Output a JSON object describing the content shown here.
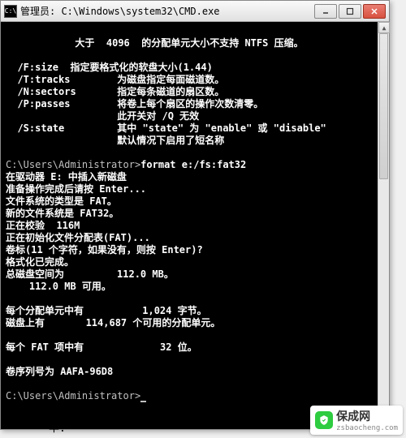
{
  "titlebar": {
    "icon_label": "C:\\",
    "text": "管理员: C:\\Windows\\system32\\CMD.exe"
  },
  "win_controls": {
    "min": "–",
    "max": "□",
    "close": "×"
  },
  "term": {
    "header_line": "大于  4096  的分配单元大小不支持 NTFS 压缩。",
    "opts": {
      "fsize": "  /F:size  指定要格式化的软盘大小(1.44)",
      "ttracks": "  /T:tracks        为磁盘指定每面磁道数。",
      "nsectors": "  /N:sectors       指定每条磁道的扇区数。",
      "ppasses": "  /P:passes        将卷上每个扇区的操作次数清零。",
      "ppasses2": "                   此开关对 /Q 无效",
      "sstate": "  /S:state         其中 \"state\" 为 \"enable\" 或 \"disable\"",
      "sstate2": "                   默认情况下启用了短名称"
    },
    "prompt1": "C:\\Users\\Administrator>",
    "cmd1": "format e:/fs:fat32",
    "body": [
      "在驱动器 E: 中插入新磁盘",
      "准备操作完成后请按 Enter...",
      "文件系统的类型是 FAT。",
      "新的文件系统是 FAT32。",
      "正在校验  116M",
      "正在初始化文件分配表(FAT)...",
      "卷标(11 个字符，如果没有，则按 Enter)?",
      "格式化已完成。",
      "总磁盘空间为         112.0 MB。",
      "    112.0 MB 可用。",
      "",
      "每个分配单元中有          1,024 字节。",
      "磁盘上有       114,687 个可用的分配单元。",
      "",
      "每个 FAT 项中有             32 位。",
      "",
      "卷序列号为 AAFA-96D8"
    ],
    "prompt2": "C:\\Users\\Administrator>"
  },
  "bottom_caption": "半:",
  "watermark": {
    "text": "保成网",
    "sub": "zsbaocheng.com"
  }
}
